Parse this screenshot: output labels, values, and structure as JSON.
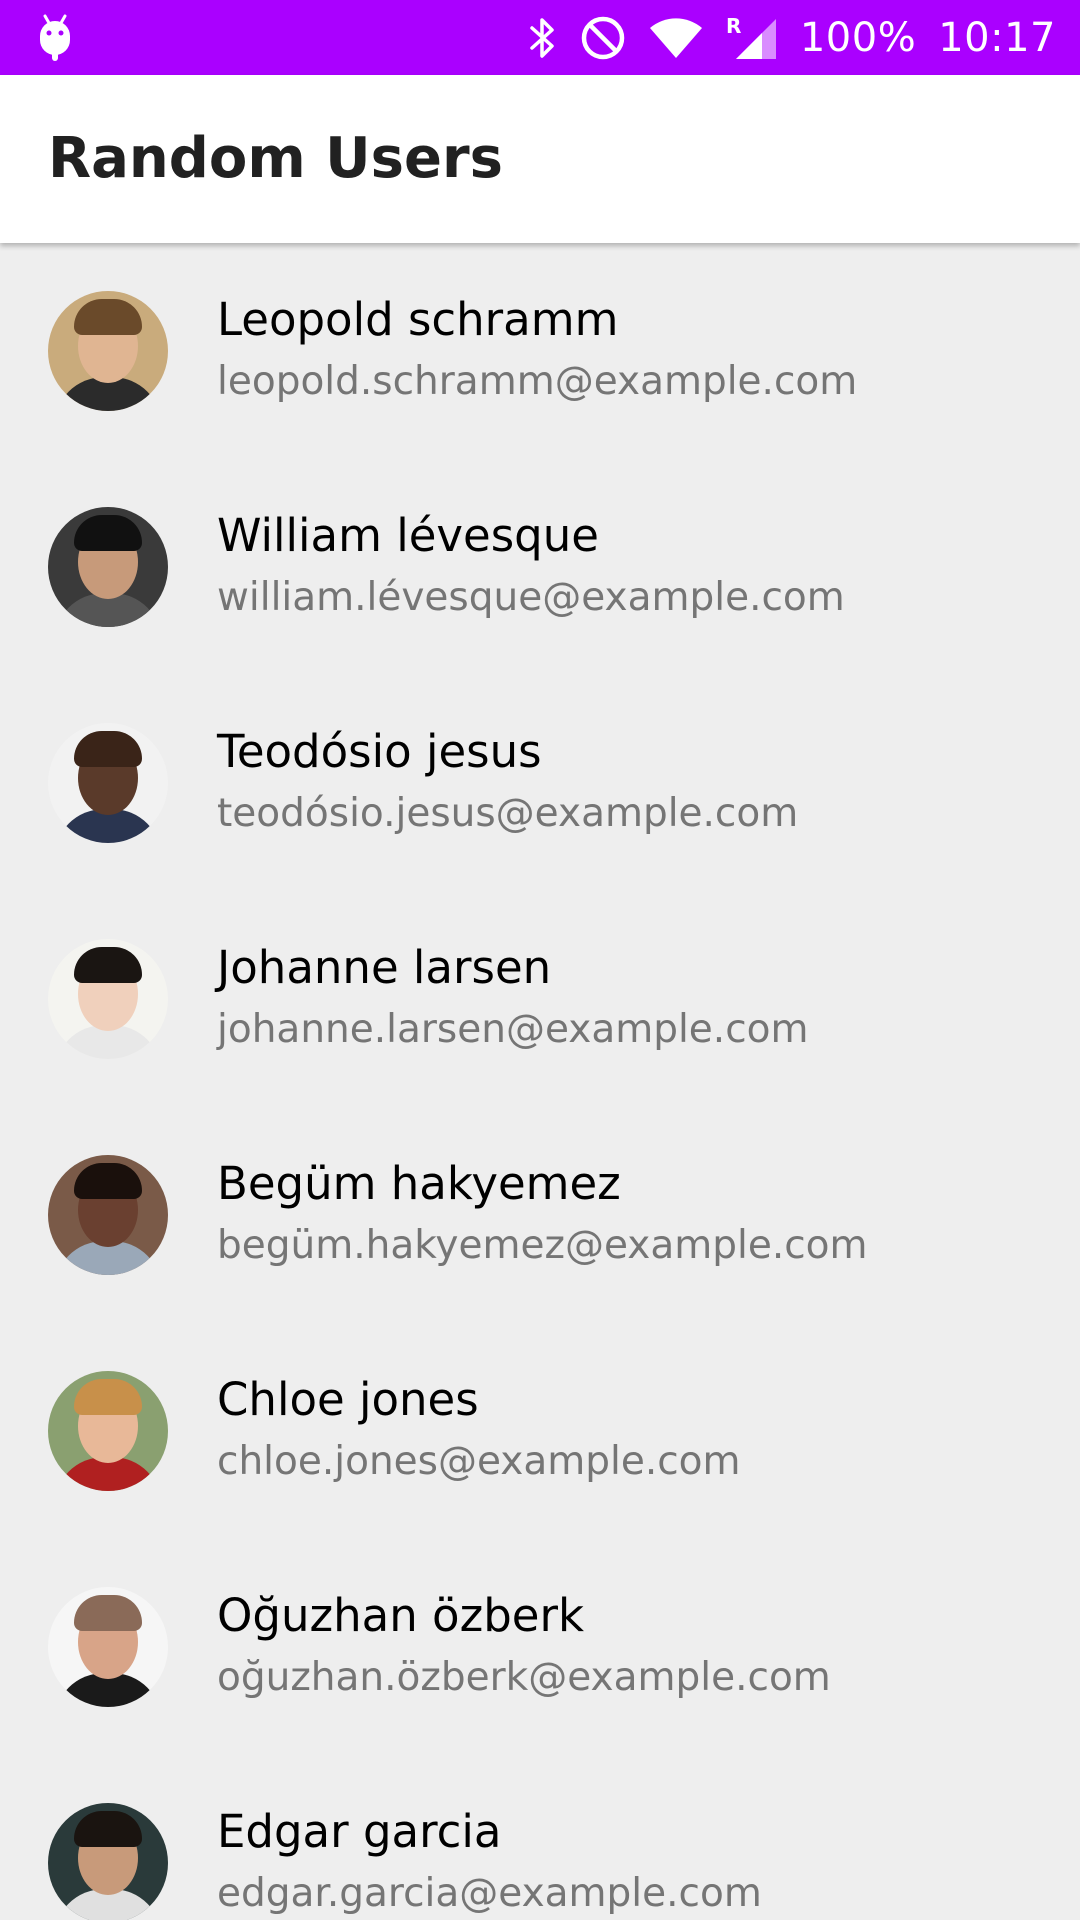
{
  "status_bar": {
    "left_icon": "android-debug-icon",
    "icons": [
      "bluetooth-icon",
      "do-not-disturb-icon",
      "wifi-icon",
      "signal-roaming-icon"
    ],
    "battery": "100%",
    "time": "10:17",
    "color": "#aa00ff"
  },
  "app_bar": {
    "title": "Random Users"
  },
  "users": [
    {
      "name": "Leopold schramm",
      "email": "leopold.schramm@example.com",
      "avatar_bg": "#c9ab7c",
      "skin": "#e0b592",
      "hair": "#6a4a2a",
      "shirt": "#2b2b2b"
    },
    {
      "name": "William lévesque",
      "email": "william.lévesque@example.com",
      "avatar_bg": "#3a3a3a",
      "skin": "#c79a7a",
      "hair": "#111111",
      "shirt": "#555555"
    },
    {
      "name": "Teodósio jesus",
      "email": "teodósio.jesus@example.com",
      "avatar_bg": "#f2f2f2",
      "skin": "#5a3a2a",
      "hair": "#3a2418",
      "shirt": "#2a3550"
    },
    {
      "name": "Johanne larsen",
      "email": "johanne.larsen@example.com",
      "avatar_bg": "#f4f4f0",
      "skin": "#f0d0bc",
      "hair": "#1a1512",
      "shirt": "#e8e8e8"
    },
    {
      "name": "Begüm hakyemez",
      "email": "begüm.hakyemez@example.com",
      "avatar_bg": "#7a5a48",
      "skin": "#6a4030",
      "hair": "#1a100c",
      "shirt": "#9aa8b8"
    },
    {
      "name": "Chloe jones",
      "email": "chloe.jones@example.com",
      "avatar_bg": "#8aa070",
      "skin": "#e8b898",
      "hair": "#c8904a",
      "shirt": "#b02020"
    },
    {
      "name": "Oğuzhan özberk",
      "email": "oğuzhan.özberk@example.com",
      "avatar_bg": "#f6f6f6",
      "skin": "#d8a488",
      "hair": "#8a6a58",
      "shirt": "#1a1a1a"
    },
    {
      "name": "Edgar garcia",
      "email": "edgar.garcia@example.com",
      "avatar_bg": "#2a3a3a",
      "skin": "#c89a7a",
      "hair": "#1a1410",
      "shirt": "#e0e0e0"
    }
  ]
}
